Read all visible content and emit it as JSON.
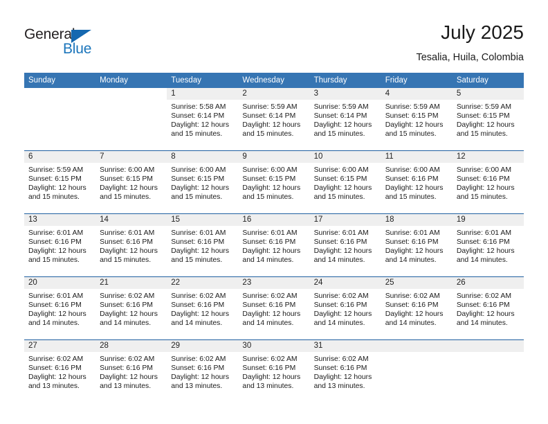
{
  "brand": {
    "name_top": "General",
    "name_bottom": "Blue",
    "triangle_color": "#1568b0",
    "blue_color": "#1b75bb"
  },
  "header": {
    "title": "July 2025",
    "subtitle": "Tesalia, Huila, Colombia"
  },
  "theme": {
    "header_row_bg": "#3675b3",
    "row_separator": "#1f5fa0",
    "daynum_band_bg": "#efefef",
    "page_bg": "#ffffff"
  },
  "weekday_headers": [
    "Sunday",
    "Monday",
    "Tuesday",
    "Wednesday",
    "Thursday",
    "Friday",
    "Saturday"
  ],
  "labels": {
    "sunrise_prefix": "Sunrise: ",
    "sunset_prefix": "Sunset: ",
    "daylight_prefix": "Daylight: "
  },
  "weeks": [
    [
      {
        "day": "",
        "sunrise": "",
        "sunset": "",
        "daylight": "",
        "blank": true
      },
      {
        "day": "",
        "sunrise": "",
        "sunset": "",
        "daylight": "",
        "blank": true
      },
      {
        "day": "1",
        "sunrise": "Sunrise: 5:58 AM",
        "sunset": "Sunset: 6:14 PM",
        "daylight": "Daylight: 12 hours and 15 minutes."
      },
      {
        "day": "2",
        "sunrise": "Sunrise: 5:59 AM",
        "sunset": "Sunset: 6:14 PM",
        "daylight": "Daylight: 12 hours and 15 minutes."
      },
      {
        "day": "3",
        "sunrise": "Sunrise: 5:59 AM",
        "sunset": "Sunset: 6:14 PM",
        "daylight": "Daylight: 12 hours and 15 minutes."
      },
      {
        "day": "4",
        "sunrise": "Sunrise: 5:59 AM",
        "sunset": "Sunset: 6:15 PM",
        "daylight": "Daylight: 12 hours and 15 minutes."
      },
      {
        "day": "5",
        "sunrise": "Sunrise: 5:59 AM",
        "sunset": "Sunset: 6:15 PM",
        "daylight": "Daylight: 12 hours and 15 minutes."
      }
    ],
    [
      {
        "day": "6",
        "sunrise": "Sunrise: 5:59 AM",
        "sunset": "Sunset: 6:15 PM",
        "daylight": "Daylight: 12 hours and 15 minutes."
      },
      {
        "day": "7",
        "sunrise": "Sunrise: 6:00 AM",
        "sunset": "Sunset: 6:15 PM",
        "daylight": "Daylight: 12 hours and 15 minutes."
      },
      {
        "day": "8",
        "sunrise": "Sunrise: 6:00 AM",
        "sunset": "Sunset: 6:15 PM",
        "daylight": "Daylight: 12 hours and 15 minutes."
      },
      {
        "day": "9",
        "sunrise": "Sunrise: 6:00 AM",
        "sunset": "Sunset: 6:15 PM",
        "daylight": "Daylight: 12 hours and 15 minutes."
      },
      {
        "day": "10",
        "sunrise": "Sunrise: 6:00 AM",
        "sunset": "Sunset: 6:15 PM",
        "daylight": "Daylight: 12 hours and 15 minutes."
      },
      {
        "day": "11",
        "sunrise": "Sunrise: 6:00 AM",
        "sunset": "Sunset: 6:16 PM",
        "daylight": "Daylight: 12 hours and 15 minutes."
      },
      {
        "day": "12",
        "sunrise": "Sunrise: 6:00 AM",
        "sunset": "Sunset: 6:16 PM",
        "daylight": "Daylight: 12 hours and 15 minutes."
      }
    ],
    [
      {
        "day": "13",
        "sunrise": "Sunrise: 6:01 AM",
        "sunset": "Sunset: 6:16 PM",
        "daylight": "Daylight: 12 hours and 15 minutes."
      },
      {
        "day": "14",
        "sunrise": "Sunrise: 6:01 AM",
        "sunset": "Sunset: 6:16 PM",
        "daylight": "Daylight: 12 hours and 15 minutes."
      },
      {
        "day": "15",
        "sunrise": "Sunrise: 6:01 AM",
        "sunset": "Sunset: 6:16 PM",
        "daylight": "Daylight: 12 hours and 15 minutes."
      },
      {
        "day": "16",
        "sunrise": "Sunrise: 6:01 AM",
        "sunset": "Sunset: 6:16 PM",
        "daylight": "Daylight: 12 hours and 14 minutes."
      },
      {
        "day": "17",
        "sunrise": "Sunrise: 6:01 AM",
        "sunset": "Sunset: 6:16 PM",
        "daylight": "Daylight: 12 hours and 14 minutes."
      },
      {
        "day": "18",
        "sunrise": "Sunrise: 6:01 AM",
        "sunset": "Sunset: 6:16 PM",
        "daylight": "Daylight: 12 hours and 14 minutes."
      },
      {
        "day": "19",
        "sunrise": "Sunrise: 6:01 AM",
        "sunset": "Sunset: 6:16 PM",
        "daylight": "Daylight: 12 hours and 14 minutes."
      }
    ],
    [
      {
        "day": "20",
        "sunrise": "Sunrise: 6:01 AM",
        "sunset": "Sunset: 6:16 PM",
        "daylight": "Daylight: 12 hours and 14 minutes."
      },
      {
        "day": "21",
        "sunrise": "Sunrise: 6:02 AM",
        "sunset": "Sunset: 6:16 PM",
        "daylight": "Daylight: 12 hours and 14 minutes."
      },
      {
        "day": "22",
        "sunrise": "Sunrise: 6:02 AM",
        "sunset": "Sunset: 6:16 PM",
        "daylight": "Daylight: 12 hours and 14 minutes."
      },
      {
        "day": "23",
        "sunrise": "Sunrise: 6:02 AM",
        "sunset": "Sunset: 6:16 PM",
        "daylight": "Daylight: 12 hours and 14 minutes."
      },
      {
        "day": "24",
        "sunrise": "Sunrise: 6:02 AM",
        "sunset": "Sunset: 6:16 PM",
        "daylight": "Daylight: 12 hours and 14 minutes."
      },
      {
        "day": "25",
        "sunrise": "Sunrise: 6:02 AM",
        "sunset": "Sunset: 6:16 PM",
        "daylight": "Daylight: 12 hours and 14 minutes."
      },
      {
        "day": "26",
        "sunrise": "Sunrise: 6:02 AM",
        "sunset": "Sunset: 6:16 PM",
        "daylight": "Daylight: 12 hours and 14 minutes."
      }
    ],
    [
      {
        "day": "27",
        "sunrise": "Sunrise: 6:02 AM",
        "sunset": "Sunset: 6:16 PM",
        "daylight": "Daylight: 12 hours and 13 minutes."
      },
      {
        "day": "28",
        "sunrise": "Sunrise: 6:02 AM",
        "sunset": "Sunset: 6:16 PM",
        "daylight": "Daylight: 12 hours and 13 minutes."
      },
      {
        "day": "29",
        "sunrise": "Sunrise: 6:02 AM",
        "sunset": "Sunset: 6:16 PM",
        "daylight": "Daylight: 12 hours and 13 minutes."
      },
      {
        "day": "30",
        "sunrise": "Sunrise: 6:02 AM",
        "sunset": "Sunset: 6:16 PM",
        "daylight": "Daylight: 12 hours and 13 minutes."
      },
      {
        "day": "31",
        "sunrise": "Sunrise: 6:02 AM",
        "sunset": "Sunset: 6:16 PM",
        "daylight": "Daylight: 12 hours and 13 minutes."
      },
      {
        "day": "",
        "sunrise": "",
        "sunset": "",
        "daylight": "",
        "empty": true
      },
      {
        "day": "",
        "sunrise": "",
        "sunset": "",
        "daylight": "",
        "empty": true
      }
    ]
  ]
}
